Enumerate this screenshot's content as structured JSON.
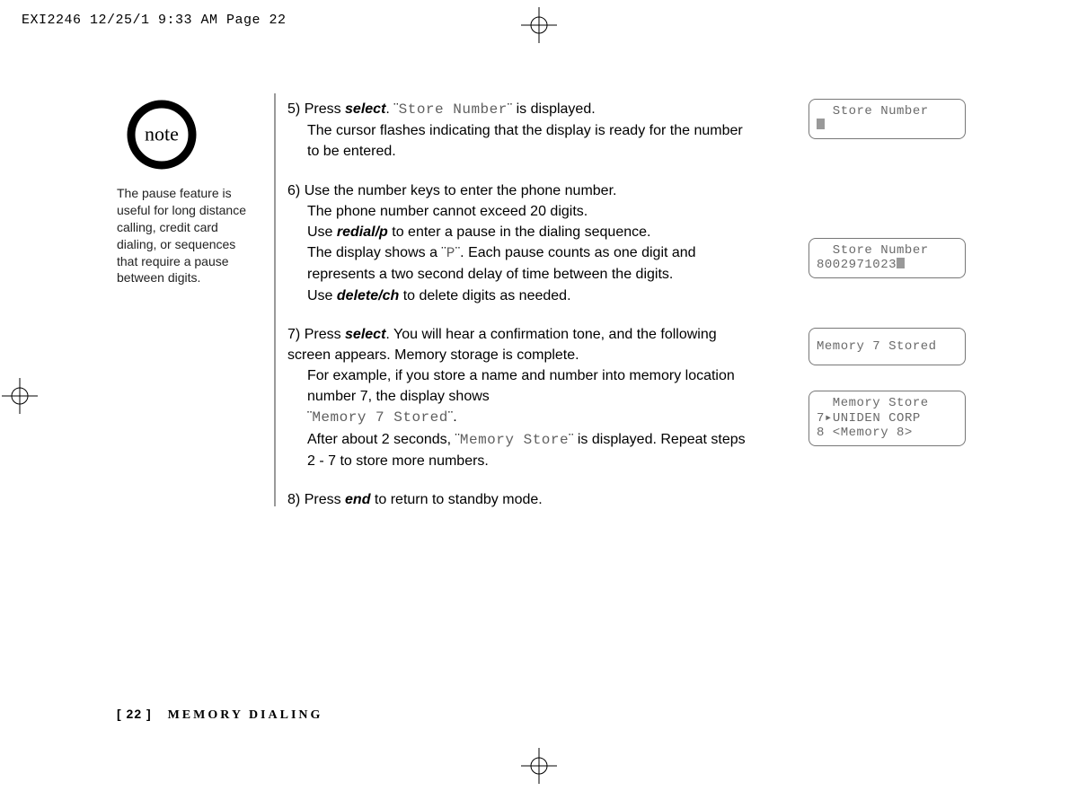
{
  "header": {
    "slug": "EXI2246  12/25/1 9:33 AM  Page 22"
  },
  "note": {
    "badge": "note",
    "text": "The pause feature is useful for long distance calling, credit card dialing, or sequences that require a pause between digits."
  },
  "steps": {
    "s5": {
      "num": "5)",
      "pre": "Press ",
      "key": "select",
      "mid": ". ¨",
      "lcd": "Store Number",
      "post": "¨ is displayed.",
      "line2": "The cursor flashes indicating that the display is ready for the number to be entered."
    },
    "s6": {
      "num": "6)",
      "l1": "Use the number keys to enter the phone number.",
      "l2": "The phone number cannot exceed 20 digits.",
      "l3a": "Use ",
      "l3key": "redial/p",
      "l3b": " to enter a pause in the dialing sequence.",
      "l4a": "The display shows a ¨",
      "l4lcd": "P",
      "l4b": "¨. Each pause counts as one digit and represents a two second delay of time between the digits.",
      "l5a": "Use ",
      "l5key": "delete/ch",
      "l5b": " to delete digits as needed."
    },
    "s7": {
      "num": "7)",
      "l1a": "Press ",
      "l1key": "select",
      "l1b": ". You will hear a confirmation tone, and the following screen appears. Memory storage is complete.",
      "l2": "For example, if you store a name and number into memory location number 7, the display shows",
      "l3a": "¨",
      "l3lcd": "Memory 7 Stored",
      "l3b": "¨.",
      "l4a": "After about 2 seconds, ¨",
      "l4lcd": "Memory Store",
      "l4b": "¨ is displayed. Repeat steps 2 - 7 to store more numbers."
    },
    "s8": {
      "num": "8)",
      "a": "Press ",
      "key": "end",
      "b": " to return to standby mode."
    }
  },
  "screens": {
    "a": {
      "l1": "  Store Number"
    },
    "b": {
      "l1": "  Store Number",
      "l2": "8002971023"
    },
    "c": {
      "l1": "Memory 7 Stored"
    },
    "d": {
      "l1": "  Memory Store",
      "l2": "7▸UNIDEN CORP",
      "l3": "8 <Memory 8>"
    }
  },
  "footer": {
    "page": "[ 22 ]",
    "section": "MEMORY DIALING"
  }
}
